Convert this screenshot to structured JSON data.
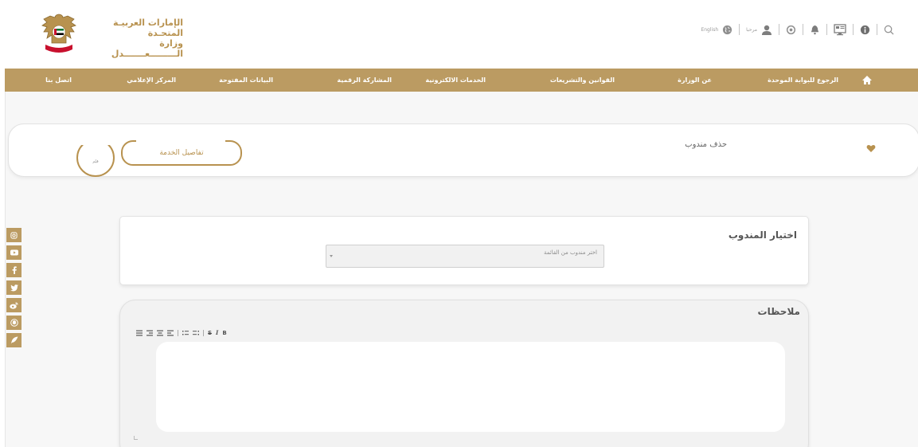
{
  "header": {
    "logo_line1": "الإمارات العربيـة المتحـدة",
    "logo_line2": "وزارة الـــــــــعـــــــدل",
    "language_label": "English",
    "greeting": "مرحبا",
    "icons": [
      "search-icon",
      "info-icon",
      "monitor-icon",
      "bell-icon",
      "settings-icon",
      "user-icon",
      "globe-icon"
    ]
  },
  "nav": {
    "items": [
      "الرجوع للبوابة الموحدة",
      "عن الوزارة",
      "القوانين والتشريعات",
      "الخدمات الالكترونية",
      "المشاركة الرقمية",
      "البيانات المفتوحة",
      "المركز الإعلامي",
      "اتصل بنا"
    ]
  },
  "service": {
    "title": "حذف مندوب",
    "details_button": "تفاصيل الخدمة",
    "rating_label": "قيّم"
  },
  "selection": {
    "title": "اختيار المندوب",
    "placeholder": "اختر مندوب من القائمة"
  },
  "notes": {
    "title": "ملاحظات",
    "toolbar": [
      "B",
      "I",
      "S"
    ]
  },
  "social": [
    "instagram-icon",
    "youtube-icon",
    "facebook-icon",
    "twitter-icon",
    "weibo-icon",
    "snapchat-icon",
    "feather-icon"
  ],
  "colors": {
    "gold": "#bb9b62",
    "gold_text": "#b8924f",
    "page_bg": "#f7f7f7"
  }
}
